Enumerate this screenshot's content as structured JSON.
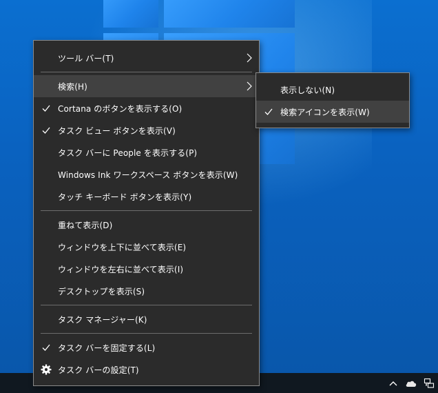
{
  "main_menu": {
    "items": [
      {
        "label": "ツール バー(T)",
        "has_submenu": true
      },
      {
        "label": "検索(H)",
        "has_submenu": true,
        "highlighted": true
      },
      {
        "label": "Cortana のボタンを表示する(O)",
        "checked": true
      },
      {
        "label": "タスク ビュー ボタンを表示(V)",
        "checked": true
      },
      {
        "label": "タスク バーに People を表示する(P)"
      },
      {
        "label": "Windows Ink ワークスペース ボタンを表示(W)"
      },
      {
        "label": "タッチ キーボード ボタンを表示(Y)"
      },
      {
        "label": "重ねて表示(D)"
      },
      {
        "label": "ウィンドウを上下に並べて表示(E)"
      },
      {
        "label": "ウィンドウを左右に並べて表示(I)"
      },
      {
        "label": "デスクトップを表示(S)"
      },
      {
        "label": "タスク マネージャー(K)"
      },
      {
        "label": "タスク バーを固定する(L)",
        "checked": true
      },
      {
        "label": "タスク バーの設定(T)",
        "icon": "gear-icon"
      }
    ]
  },
  "search_submenu": {
    "items": [
      {
        "label": "表示しない(N)"
      },
      {
        "label": "検索アイコンを表示(W)",
        "checked": true,
        "highlighted": true
      }
    ]
  },
  "taskbar": {
    "tray_icons": [
      "chevron-up-icon",
      "onedrive-cloud-icon",
      "network-icon"
    ]
  },
  "colors": {
    "menu_bg": "#2b2b2b",
    "menu_highlight": "#414141",
    "menu_border": "#8a8a8a",
    "desktop_blue": "#0a62c0",
    "taskbar_bg": "#101820"
  }
}
